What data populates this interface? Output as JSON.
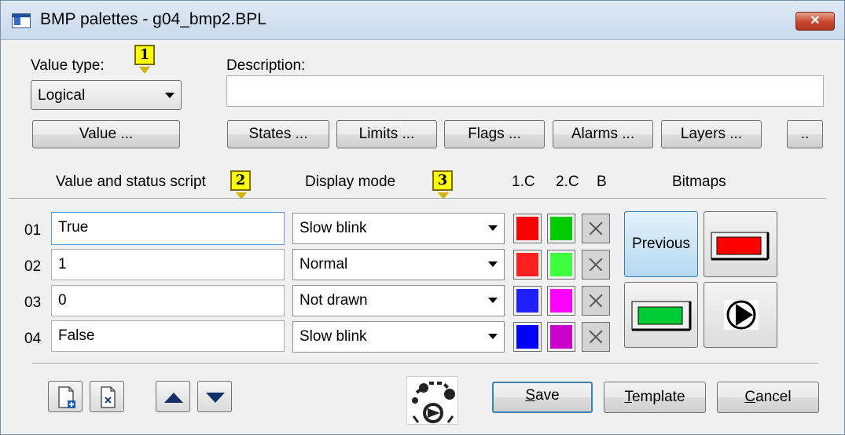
{
  "window": {
    "title": "BMP palettes - g04_bmp2.BPL",
    "close_glyph": "✕"
  },
  "value_type": {
    "label": "Value type:",
    "selected": "Logical"
  },
  "description": {
    "label": "Description:",
    "value": ""
  },
  "buttons": {
    "value": "Value ...",
    "states": "States ...",
    "limits": "Limits ...",
    "flags": "Flags ...",
    "alarms": "Alarms ...",
    "layers": "Layers ...",
    "more": ".."
  },
  "markers": [
    "1",
    "2",
    "3"
  ],
  "columns": {
    "script": "Value and status script",
    "display_mode": "Display mode",
    "c1": "1.C",
    "c2": "2.C",
    "b": "B",
    "bitmaps": "Bitmaps"
  },
  "rows": [
    {
      "num": "01",
      "script": "True",
      "mode": "Slow blink",
      "color1": "#ff0000",
      "color2": "#00cc00"
    },
    {
      "num": "02",
      "script": "1",
      "mode": "Normal",
      "color1": "#ff2020",
      "color2": "#40ff40"
    },
    {
      "num": "03",
      "script": "0",
      "mode": "Not drawn",
      "color1": "#2020ff",
      "color2": "#ff00ff"
    },
    {
      "num": "04",
      "script": "False",
      "mode": "Slow blink",
      "color1": "#0000ff",
      "color2": "#cc00cc"
    }
  ],
  "bitmaps": {
    "previous_label": "Previous"
  },
  "footer": {
    "save": "Save",
    "save_key": "S",
    "save_rest": "ave",
    "template_key": "T",
    "template_rest": "emplate",
    "cancel_key": "C",
    "cancel_rest": "ancel"
  }
}
